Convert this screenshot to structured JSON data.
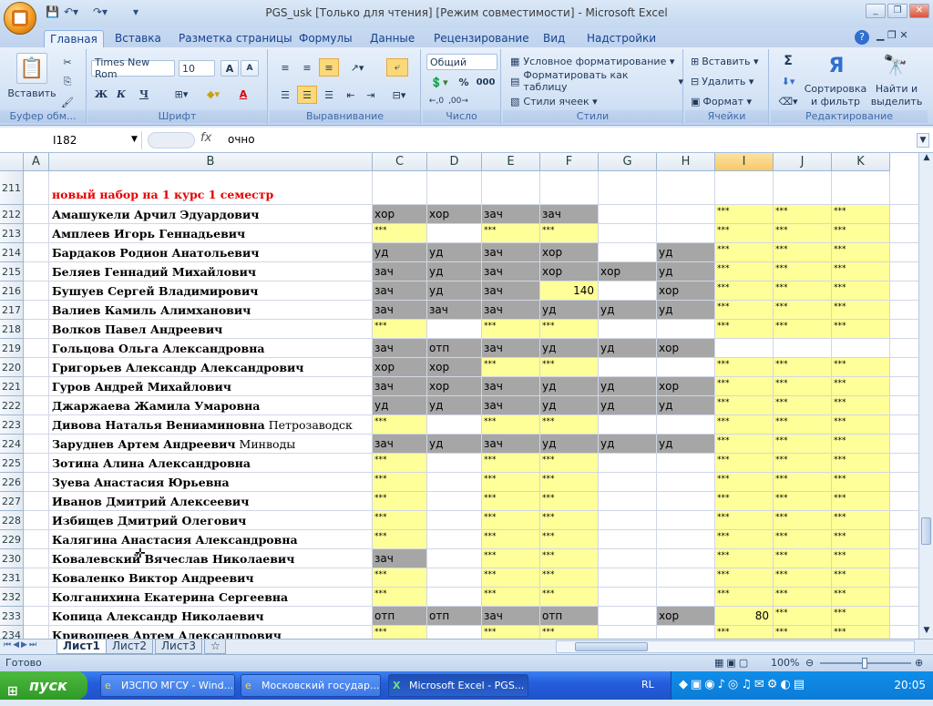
{
  "window": {
    "title": "PGS_usk  [Только для чтения]  [Режим совместимости] - Microsoft Excel",
    "controls": {
      "minimize": "_",
      "restore": "❐",
      "close": "✕"
    }
  },
  "ribbon_tabs": [
    "Главная",
    "Вставка",
    "Разметка страницы",
    "Формулы",
    "Данные",
    "Рецензирование",
    "Вид",
    "Надстройки"
  ],
  "ribbon": {
    "clipboard": {
      "paste": "Вставить",
      "label": "Буфер обм..."
    },
    "font": {
      "name": "Times New Rom",
      "size": "10",
      "bold": "Ж",
      "italic": "К",
      "underline": "Ч",
      "font_color_letter": "А",
      "label": "Шрифт"
    },
    "alignment": {
      "label": "Выравнивание"
    },
    "number": {
      "format": "Общий",
      "percent": "%",
      "thousands": "000",
      "label": "Число"
    },
    "styles": {
      "conditional": "Условное форматирование",
      "as_table": "Форматировать как таблицу",
      "cell_styles": "Стили ячеек",
      "label": "Стили"
    },
    "cells": {
      "insert": "Вставить",
      "delete": "Удалить",
      "format": "Формат",
      "label": "Ячейки"
    },
    "editing": {
      "sigma": "Σ",
      "sort": "Сортировка",
      "sort2": "и фильтр",
      "find": "Найти и",
      "find2": "выделить",
      "label": "Редактирование"
    }
  },
  "formula_bar": {
    "name_box": "I182",
    "fx": "fx",
    "value": "очно"
  },
  "columns": [
    "A",
    "B",
    "C",
    "D",
    "E",
    "F",
    "G",
    "H",
    "I",
    "J",
    "K"
  ],
  "rows": [
    {
      "n": "211",
      "name": "новый набор на 1 курс 1 семестр",
      "header": true,
      "cells": [
        "",
        "",
        "",
        "",
        "",
        "",
        "",
        "",
        ""
      ]
    },
    {
      "n": "212",
      "name": "Амашукели Арчил Эдуардович",
      "cells": [
        "хор",
        "хор",
        "зач",
        "зач",
        "",
        "",
        "***",
        "***",
        "***"
      ]
    },
    {
      "n": "213",
      "name": "Амплеев Игорь Геннадьевич",
      "cells": [
        "***",
        "",
        "***",
        "***",
        "",
        "",
        "***",
        "***",
        "***"
      ]
    },
    {
      "n": "214",
      "name": "Бардаков Родион Анатольевич",
      "cells": [
        "уд",
        "уд",
        "зач",
        "хор",
        "",
        "уд",
        "***",
        "***",
        "***"
      ]
    },
    {
      "n": "215",
      "name": "Беляев Геннадий Михайлович",
      "cells": [
        "зач",
        "уд",
        "зач",
        "хор",
        "хор",
        "уд",
        "***",
        "***",
        "***"
      ]
    },
    {
      "n": "216",
      "name": "Бушуев Сергей Владимирович",
      "cells": [
        "зач",
        "уд",
        "зач",
        "140",
        "",
        "хор",
        "***",
        "***",
        "***"
      ]
    },
    {
      "n": "217",
      "name": "Валиев Камиль Алимханович",
      "cells": [
        "зач",
        "зач",
        "зач",
        "уд",
        "уд",
        "уд",
        "***",
        "***",
        "***"
      ]
    },
    {
      "n": "218",
      "name": "Волков Павел Андреевич",
      "cells": [
        "***",
        "",
        "***",
        "***",
        "",
        "",
        "***",
        "***",
        "***"
      ]
    },
    {
      "n": "219",
      "name": "Гольцова Ольга Александровна",
      "cells": [
        "зач",
        "отп",
        "зач",
        "уд",
        "уд",
        "хор",
        "",
        "",
        ""
      ]
    },
    {
      "n": "220",
      "name": "Григорьев Александр Александрович",
      "cells": [
        "хор",
        "хор",
        "***",
        "***",
        "",
        "",
        "***",
        "***",
        "***"
      ]
    },
    {
      "n": "221",
      "name": "Гуров Андрей Михайлович",
      "cells": [
        "зач",
        "хор",
        "зач",
        "уд",
        "уд",
        "хор",
        "***",
        "***",
        "***"
      ]
    },
    {
      "n": "222",
      "name": "Джаржаева Жамила Умаровна",
      "cells": [
        "уд",
        "уд",
        "зач",
        "уд",
        "уд",
        "уд",
        "***",
        "***",
        "***"
      ]
    },
    {
      "n": "223",
      "name": "Дивова Наталья Вениаминовна",
      "extra": " Петрозаводск",
      "cells": [
        "***",
        "",
        "***",
        "***",
        "",
        "",
        "***",
        "***",
        "***"
      ]
    },
    {
      "n": "224",
      "name": "Заруднев Артем Андреевич",
      "extra": " Минводы",
      "cells": [
        "зач",
        "уд",
        "зач",
        "уд",
        "уд",
        "уд",
        "***",
        "***",
        "***"
      ]
    },
    {
      "n": "225",
      "name": "Зотина Алина Александровна",
      "cells": [
        "***",
        "",
        "***",
        "***",
        "",
        "",
        "***",
        "***",
        "***"
      ]
    },
    {
      "n": "226",
      "name": "Зуева Анастасия Юрьевна",
      "cells": [
        "***",
        "",
        "***",
        "***",
        "",
        "",
        "***",
        "***",
        "***"
      ]
    },
    {
      "n": "227",
      "name": "Иванов Дмитрий Алексеевич",
      "cells": [
        "***",
        "",
        "***",
        "***",
        "",
        "",
        "***",
        "***",
        "***"
      ]
    },
    {
      "n": "228",
      "name": "Избищев Дмитрий Олегович",
      "cells": [
        "***",
        "",
        "***",
        "***",
        "",
        "",
        "***",
        "***",
        "***"
      ]
    },
    {
      "n": "229",
      "name": "Калягина Анастасия Александровна",
      "cells": [
        "***",
        "",
        "***",
        "***",
        "",
        "",
        "***",
        "***",
        "***"
      ]
    },
    {
      "n": "230",
      "name": "Ковалевский Вячеслав Николаевич",
      "cells": [
        "зач",
        "",
        "***",
        "***",
        "",
        "",
        "***",
        "***",
        "***"
      ]
    },
    {
      "n": "231",
      "name": "Коваленко Виктор Андреевич",
      "cells": [
        "***",
        "",
        "***",
        "***",
        "",
        "",
        "***",
        "***",
        "***"
      ]
    },
    {
      "n": "232",
      "name": "Колганихина Екатерина Сергеевна",
      "cells": [
        "***",
        "",
        "***",
        "***",
        "",
        "",
        "***",
        "***",
        "***"
      ]
    },
    {
      "n": "233",
      "name": "Копица Александр Николаевич",
      "cells": [
        "отп",
        "отп",
        "зач",
        "отп",
        "",
        "хор",
        "80",
        "***",
        "***"
      ]
    },
    {
      "n": "234",
      "name": "Кривошеев Артем Александрович",
      "cells": [
        "***",
        "",
        "***",
        "***",
        "",
        "",
        "***",
        "***",
        "***"
      ]
    }
  ],
  "sheets": [
    "Лист1",
    "Лист2",
    "Лист3"
  ],
  "status": {
    "ready": "Готово",
    "zoom": "100%"
  },
  "taskbar": {
    "start": "пуск",
    "items": [
      "ИЗСПО МГСУ - Wind...",
      "Московский государ...",
      "Microsoft Excel - PGS..."
    ],
    "lang": "RL",
    "clock": "20:05"
  },
  "colors": {
    "yellow": "#ffff99",
    "gray": "#a6a6a6",
    "header_red": "#e60000",
    "selected_col": "#f7c96b"
  }
}
